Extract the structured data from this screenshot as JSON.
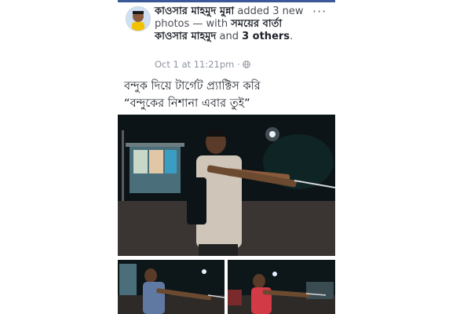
{
  "post": {
    "author": "কাওসার মাহমুদ মুন্না",
    "action": "added 3 new photos — with",
    "tagged_1": "সময়ের বার্তা কাওসার মাহমুদ",
    "and_word": "and",
    "tagged_others": "3 others",
    "period": ".",
    "more_glyph": "···",
    "timestamp": "Oct 1 at 11:21pm",
    "separator": "·",
    "privacy_icon": "globe-icon",
    "caption_line_1": "বন্দুক দিয়ে টার্গেট প্র্যাক্টিস করি",
    "caption_line_2": "“বন্দুকের নিশানা এবার তুই”"
  },
  "photos": [
    {
      "name": "main-photo",
      "description_icon": "photo"
    },
    {
      "name": "bottom-left-photo",
      "description_icon": "photo"
    },
    {
      "name": "bottom-right-photo",
      "description_icon": "photo"
    }
  ],
  "colors": {
    "brand": "#3b5998",
    "text": "#1d2129",
    "meta": "#8d949e"
  }
}
